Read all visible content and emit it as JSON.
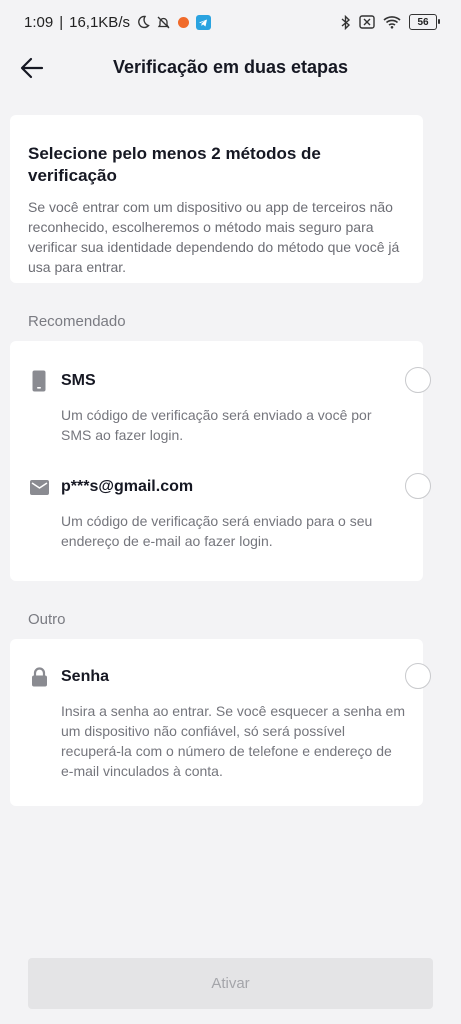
{
  "status_bar": {
    "time": "1:09",
    "speed": "16,1KB/s",
    "battery": "56"
  },
  "header": {
    "title": "Verificação em duas etapas"
  },
  "intro": {
    "title": "Selecione pelo menos 2 métodos de verificação",
    "text": "Se você entrar com um dispositivo ou app de terceiros não reconhecido, escolheremos o método mais seguro para verificar sua identidade dependendo do método que você já usa para entrar."
  },
  "sections": {
    "recommended_label": "Recomendado",
    "other_label": "Outro"
  },
  "options": {
    "sms": {
      "title": "SMS",
      "desc": "Um código de verificação será enviado a você por SMS ao fazer login.",
      "icon": "phone-icon",
      "selected": false
    },
    "email": {
      "title": "p***s@gmail.com",
      "desc": "Um código de verificação será enviado para o seu endereço de e-mail ao fazer login.",
      "icon": "mail-icon",
      "selected": false
    },
    "password": {
      "title": "Senha",
      "desc": "Insira a senha ao entrar. Se você esquecer a senha em um dispositivo não confiável, só será possível recuperá-la com o número de telefone e endereço de e-mail vinculados à conta.",
      "icon": "lock-icon",
      "selected": false
    }
  },
  "footer": {
    "activate_label": "Ativar"
  }
}
